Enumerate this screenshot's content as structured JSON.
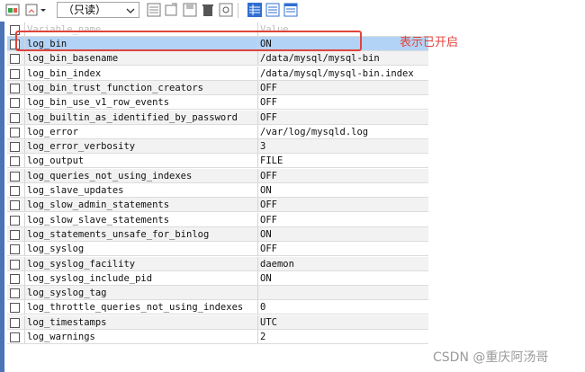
{
  "toolbar": {
    "mode_select": "（只读）",
    "colors": {
      "green": "#3aa34a",
      "blue": "#2f6fd1",
      "gray": "#6b6b6b"
    }
  },
  "table": {
    "header": {
      "name": "Variable_name",
      "value": "Value"
    },
    "rows": [
      {
        "name": "log_bin",
        "value": "ON"
      },
      {
        "name": "log_bin_basename",
        "value": "/data/mysql/mysql-bin"
      },
      {
        "name": "log_bin_index",
        "value": "/data/mysql/mysql-bin.index"
      },
      {
        "name": "log_bin_trust_function_creators",
        "value": "OFF"
      },
      {
        "name": "log_bin_use_v1_row_events",
        "value": "OFF"
      },
      {
        "name": "log_builtin_as_identified_by_password",
        "value": "OFF"
      },
      {
        "name": "log_error",
        "value": "/var/log/mysqld.log"
      },
      {
        "name": "log_error_verbosity",
        "value": "3"
      },
      {
        "name": "log_output",
        "value": "FILE"
      },
      {
        "name": "log_queries_not_using_indexes",
        "value": "OFF"
      },
      {
        "name": "log_slave_updates",
        "value": "ON"
      },
      {
        "name": "log_slow_admin_statements",
        "value": "OFF"
      },
      {
        "name": "log_slow_slave_statements",
        "value": "OFF"
      },
      {
        "name": "log_statements_unsafe_for_binlog",
        "value": "ON"
      },
      {
        "name": "log_syslog",
        "value": "OFF"
      },
      {
        "name": "log_syslog_facility",
        "value": "daemon"
      },
      {
        "name": "log_syslog_include_pid",
        "value": "ON"
      },
      {
        "name": "log_syslog_tag",
        "value": ""
      },
      {
        "name": "log_throttle_queries_not_using_indexes",
        "value": "0"
      },
      {
        "name": "log_timestamps",
        "value": "UTC"
      },
      {
        "name": "log_warnings",
        "value": "2"
      }
    ]
  },
  "annotation": {
    "text": "表示已开启",
    "color": "#e0443c"
  },
  "watermark": "CSDN @重庆阿汤哥"
}
